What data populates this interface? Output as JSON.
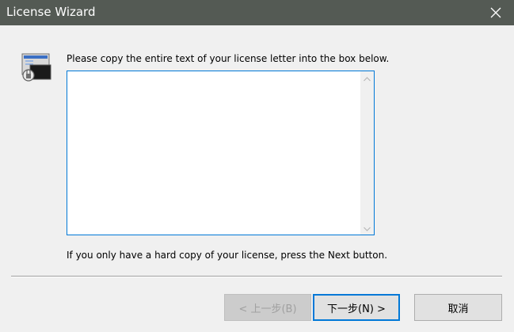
{
  "window": {
    "title": "License Wizard",
    "close_icon": "close-icon"
  },
  "wizard": {
    "icon": "license-wizard-icon",
    "instruction": "Please copy the entire text of your license letter into the box below.",
    "license_text": "",
    "hint": "If you only have a hard copy of your license, press the Next button."
  },
  "buttons": {
    "back_label": "< 上一步(B)",
    "next_label": "下一步(N) >",
    "cancel_label": "取消"
  },
  "colors": {
    "titlebar": "#545a54",
    "accent": "#0078d7",
    "background": "#f0f0f0"
  }
}
